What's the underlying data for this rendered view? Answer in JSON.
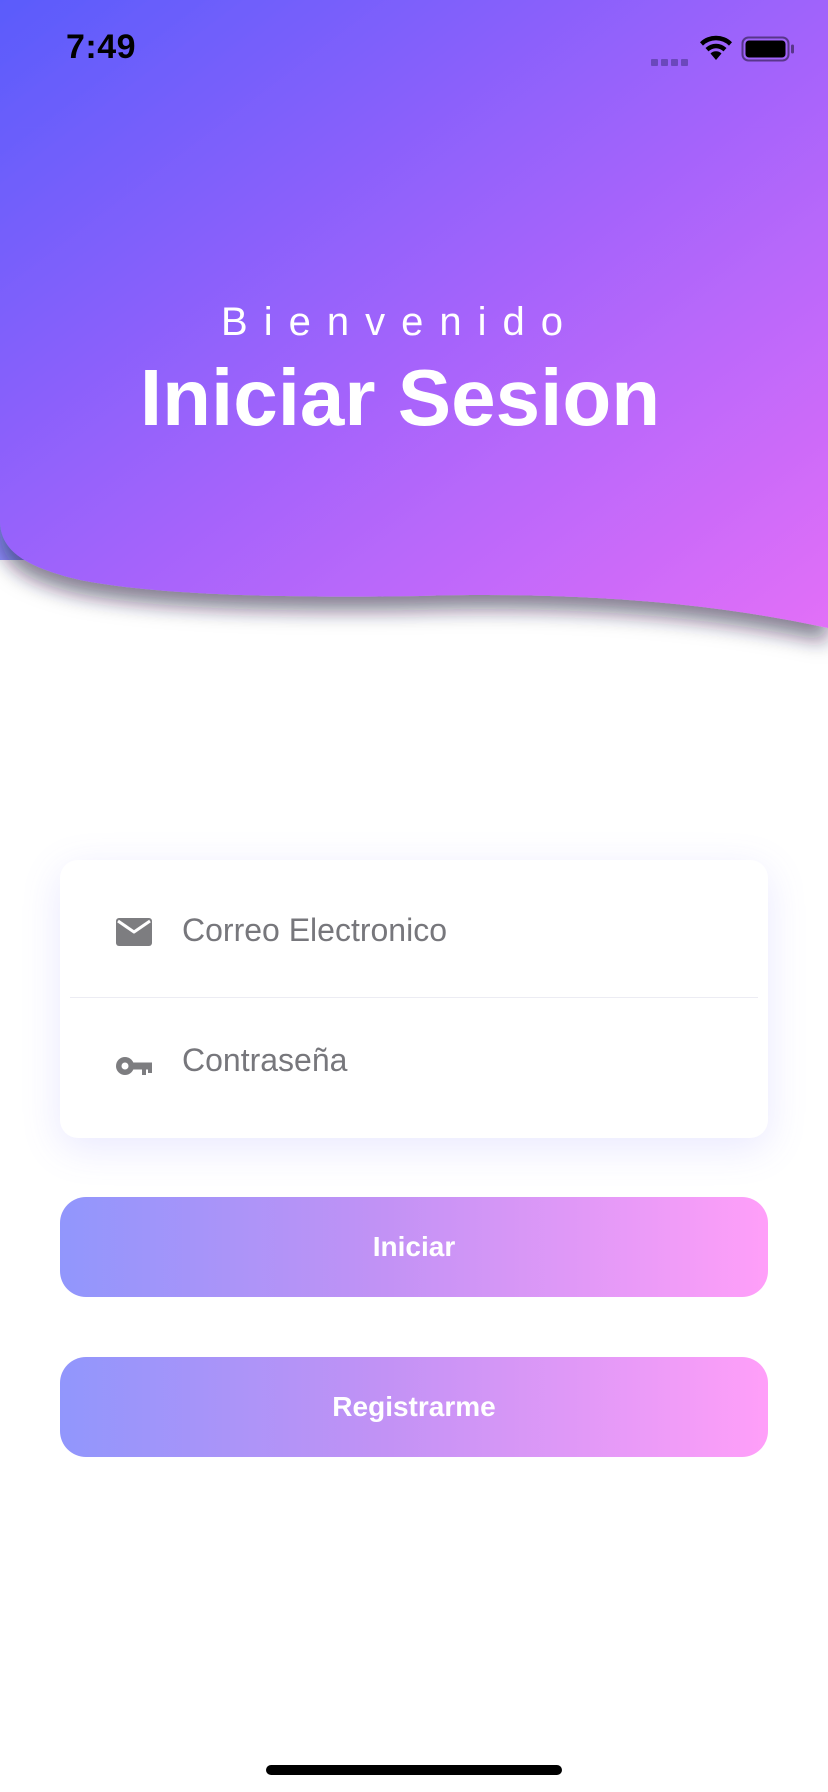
{
  "status_bar": {
    "time": "7:49"
  },
  "header": {
    "welcome": "Bienvenido",
    "title": "Iniciar Sesion",
    "gradient_colors": [
      "#5c5cfc",
      "#a564fb",
      "#dc6bf8"
    ]
  },
  "form": {
    "email": {
      "placeholder": "Correo Electronico",
      "value": "",
      "icon": "mail-icon"
    },
    "password": {
      "placeholder": "Contraseña",
      "value": "",
      "icon": "key-icon"
    }
  },
  "buttons": {
    "login_label": "Iniciar",
    "register_label": "Registrarme",
    "gradient_colors": [
      "#9196fc",
      "#ff9ff9"
    ]
  }
}
